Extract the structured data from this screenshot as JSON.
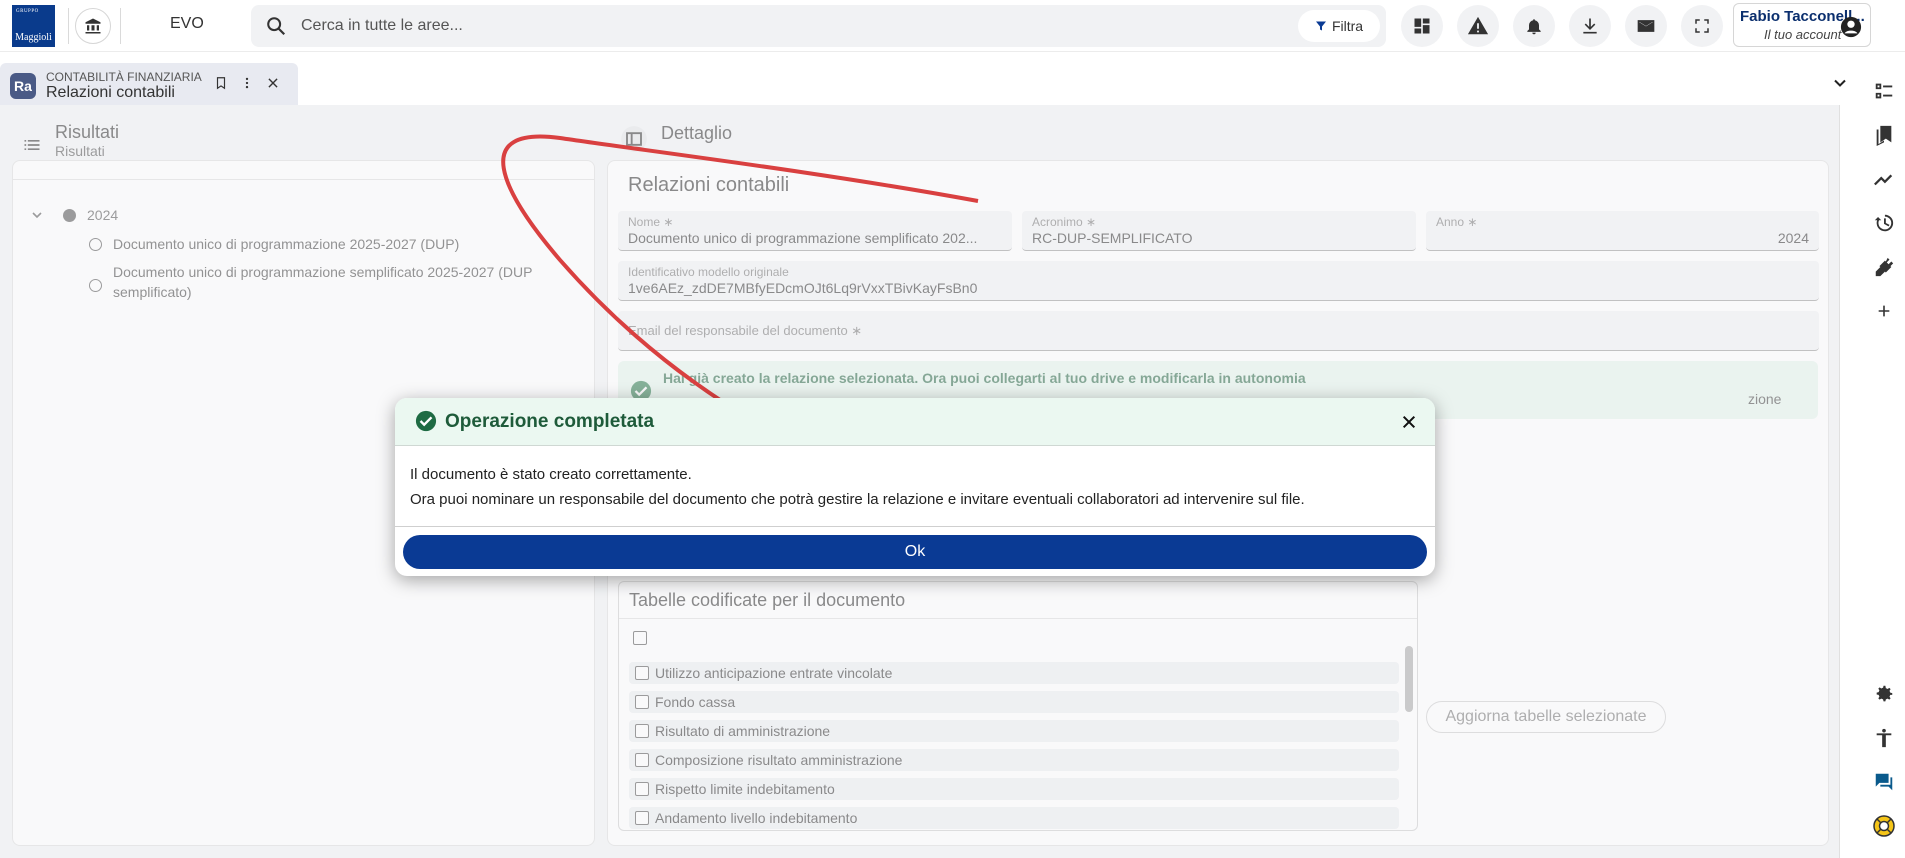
{
  "header": {
    "logo_top": "GRUPPO",
    "logo_text": "Maggioli",
    "app_name": "EVO",
    "search_placeholder": "Cerca in tutte le aree...",
    "filter_label": "Filtra",
    "account_name": "Fabio Tacconell...",
    "account_sub": "Il tuo account"
  },
  "tab": {
    "badge": "Ra",
    "category": "CONTABILITÀ FINANZIARIA",
    "title": "Relazioni contabili"
  },
  "left": {
    "title": "Risultati",
    "subtitle": "Risultati",
    "tree_year": "2024",
    "items": [
      "Documento unico di programmazione 2025-2027 (DUP)",
      "Documento unico di programmazione semplificato 2025-2027 (DUP semplificato)"
    ]
  },
  "detail": {
    "head": "Dettaglio",
    "title": "Relazioni contabili",
    "fields": {
      "nome_label": "Nome ∗",
      "nome_value": "Documento unico di programmazione semplificato 202...",
      "acronimo_label": "Acronimo ∗",
      "acronimo_value": "RC-DUP-SEMPLIFICATO",
      "anno_label": "Anno ∗",
      "anno_value": "2024",
      "id_label": "Identificativo modello originale",
      "id_value": "1ve6AEz_zdDE7MBfyEDcmOJt6Lq9rVxxTBivKayFsBn0",
      "email_label": "Email del responsabile del documento ∗"
    },
    "banner_title": "Hai già creato la relazione selezionata. Ora puoi collegarti al tuo drive e modificarla in autonomia",
    "banner_sub": "zione",
    "tables_title": "Tabelle codificate per il documento",
    "tables": [
      "Utilizzo anticipazione entrate vincolate",
      "Fondo cassa",
      "Risultato di amministrazione",
      "Composizione risultato amministrazione",
      "Rispetto limite indebitamento",
      "Andamento livello indebitamento"
    ],
    "update_button": "Aggiorna tabelle selezionate"
  },
  "modal": {
    "title": "Operazione completata",
    "line1": "Il documento è stato creato correttamente.",
    "line2": "Ora puoi nominare un responsabile del documento che potrà gestire la relazione e invitare eventuali collaboratori ad intervenire sul file.",
    "ok_label": "Ok"
  },
  "colors": {
    "brand": "#0a3a94",
    "success": "#2e7d4f",
    "arrow": "#d94040"
  }
}
